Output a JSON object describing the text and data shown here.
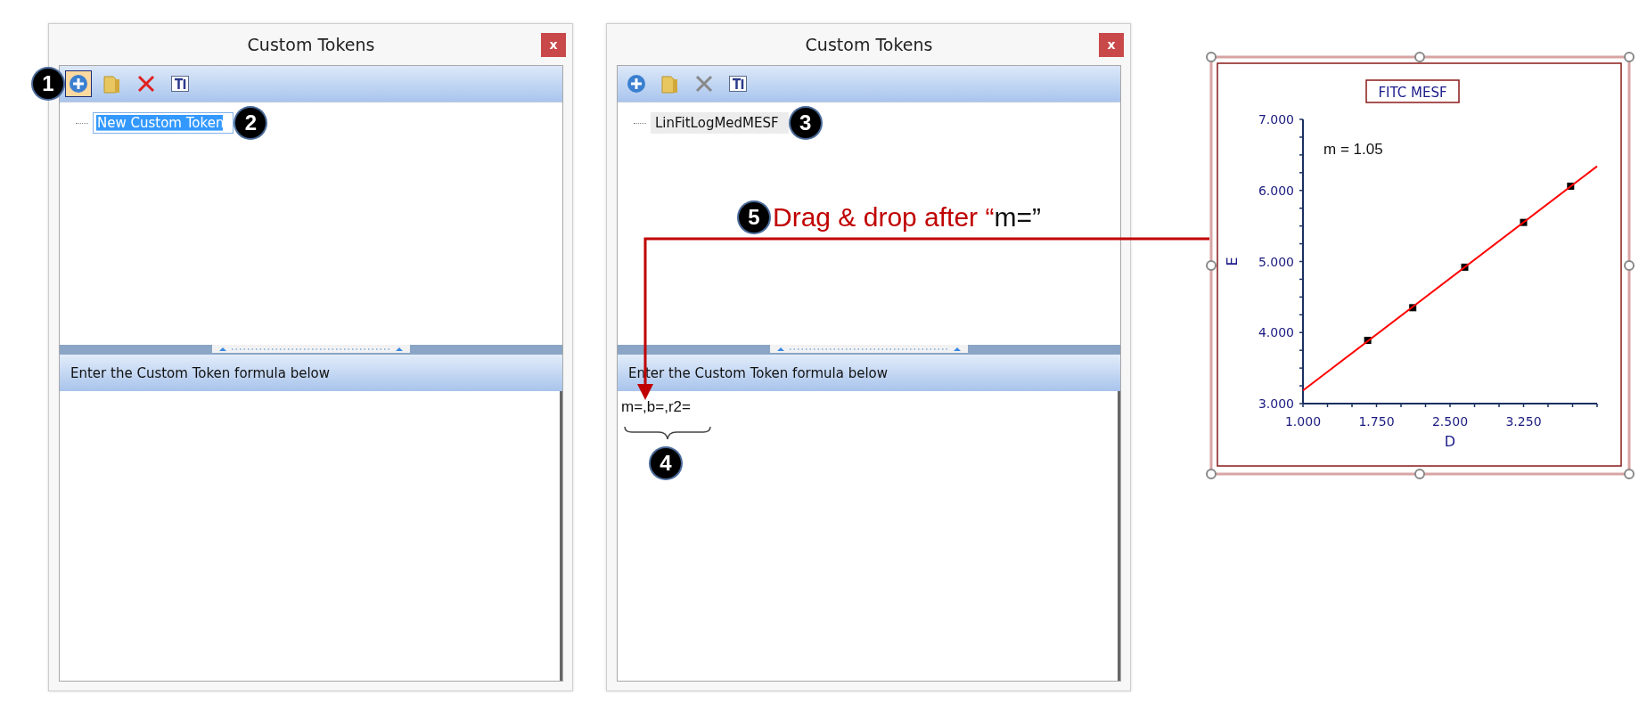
{
  "windows": [
    {
      "title": "Custom Tokens",
      "close_label": "x",
      "toolbar_callout": "1",
      "toolbar": [
        {
          "kind": "add",
          "selected": true,
          "disabled": false
        },
        {
          "kind": "folder",
          "selected": false,
          "disabled": false
        },
        {
          "kind": "delete",
          "selected": false,
          "disabled": false
        },
        {
          "kind": "text",
          "selected": false,
          "disabled": false
        }
      ],
      "tree": [
        {
          "label": "New Custom Token",
          "editing": true,
          "callout": "2"
        }
      ],
      "formula_header": "Enter the Custom Token formula below"
    },
    {
      "title": "Custom Tokens",
      "close_label": "x",
      "toolbar": [
        {
          "kind": "add",
          "selected": false,
          "disabled": false
        },
        {
          "kind": "folder",
          "selected": false,
          "disabled": false
        },
        {
          "kind": "delete",
          "selected": false,
          "disabled": true
        },
        {
          "kind": "text",
          "selected": false,
          "disabled": false
        }
      ],
      "tree": [
        {
          "label": "LinFitLogMedMESF",
          "editing": false,
          "callout": "3"
        }
      ],
      "formula_header": "Enter the Custom Token formula below",
      "formula_value": "m=,b=,r2=",
      "formula_callout": "4"
    }
  ],
  "instruction": {
    "callout": "5",
    "text": "Drag & drop after “",
    "quoted": "m=”"
  },
  "chart": {
    "chart_data": {
      "type": "scatter",
      "title": "FITC MESF",
      "xlabel": "D",
      "ylabel": "E",
      "x": [
        1.66,
        2.12,
        2.65,
        3.25,
        3.73
      ],
      "series": [
        {
          "color": "#000000",
          "values": [
            3.89,
            4.35,
            4.92,
            5.55,
            6.06
          ]
        }
      ],
      "xlim": [
        1,
        4
      ],
      "ylim": [
        3,
        7
      ],
      "xticks": [
        {
          "value": 1,
          "label": "1.000"
        },
        {
          "value": 1.75,
          "label": "1.750"
        },
        {
          "value": 2.5,
          "label": "2.500"
        },
        {
          "value": 3.25,
          "label": "3.250"
        }
      ],
      "yticks": [
        {
          "value": 3,
          "label": "3.000"
        },
        {
          "value": 4,
          "label": "4.000"
        },
        {
          "value": 5,
          "label": "5.000"
        },
        {
          "value": 6,
          "label": "6.000"
        },
        {
          "value": 7,
          "label": "7.000"
        }
      ],
      "annotations": [
        "m = 1.05"
      ]
    }
  }
}
